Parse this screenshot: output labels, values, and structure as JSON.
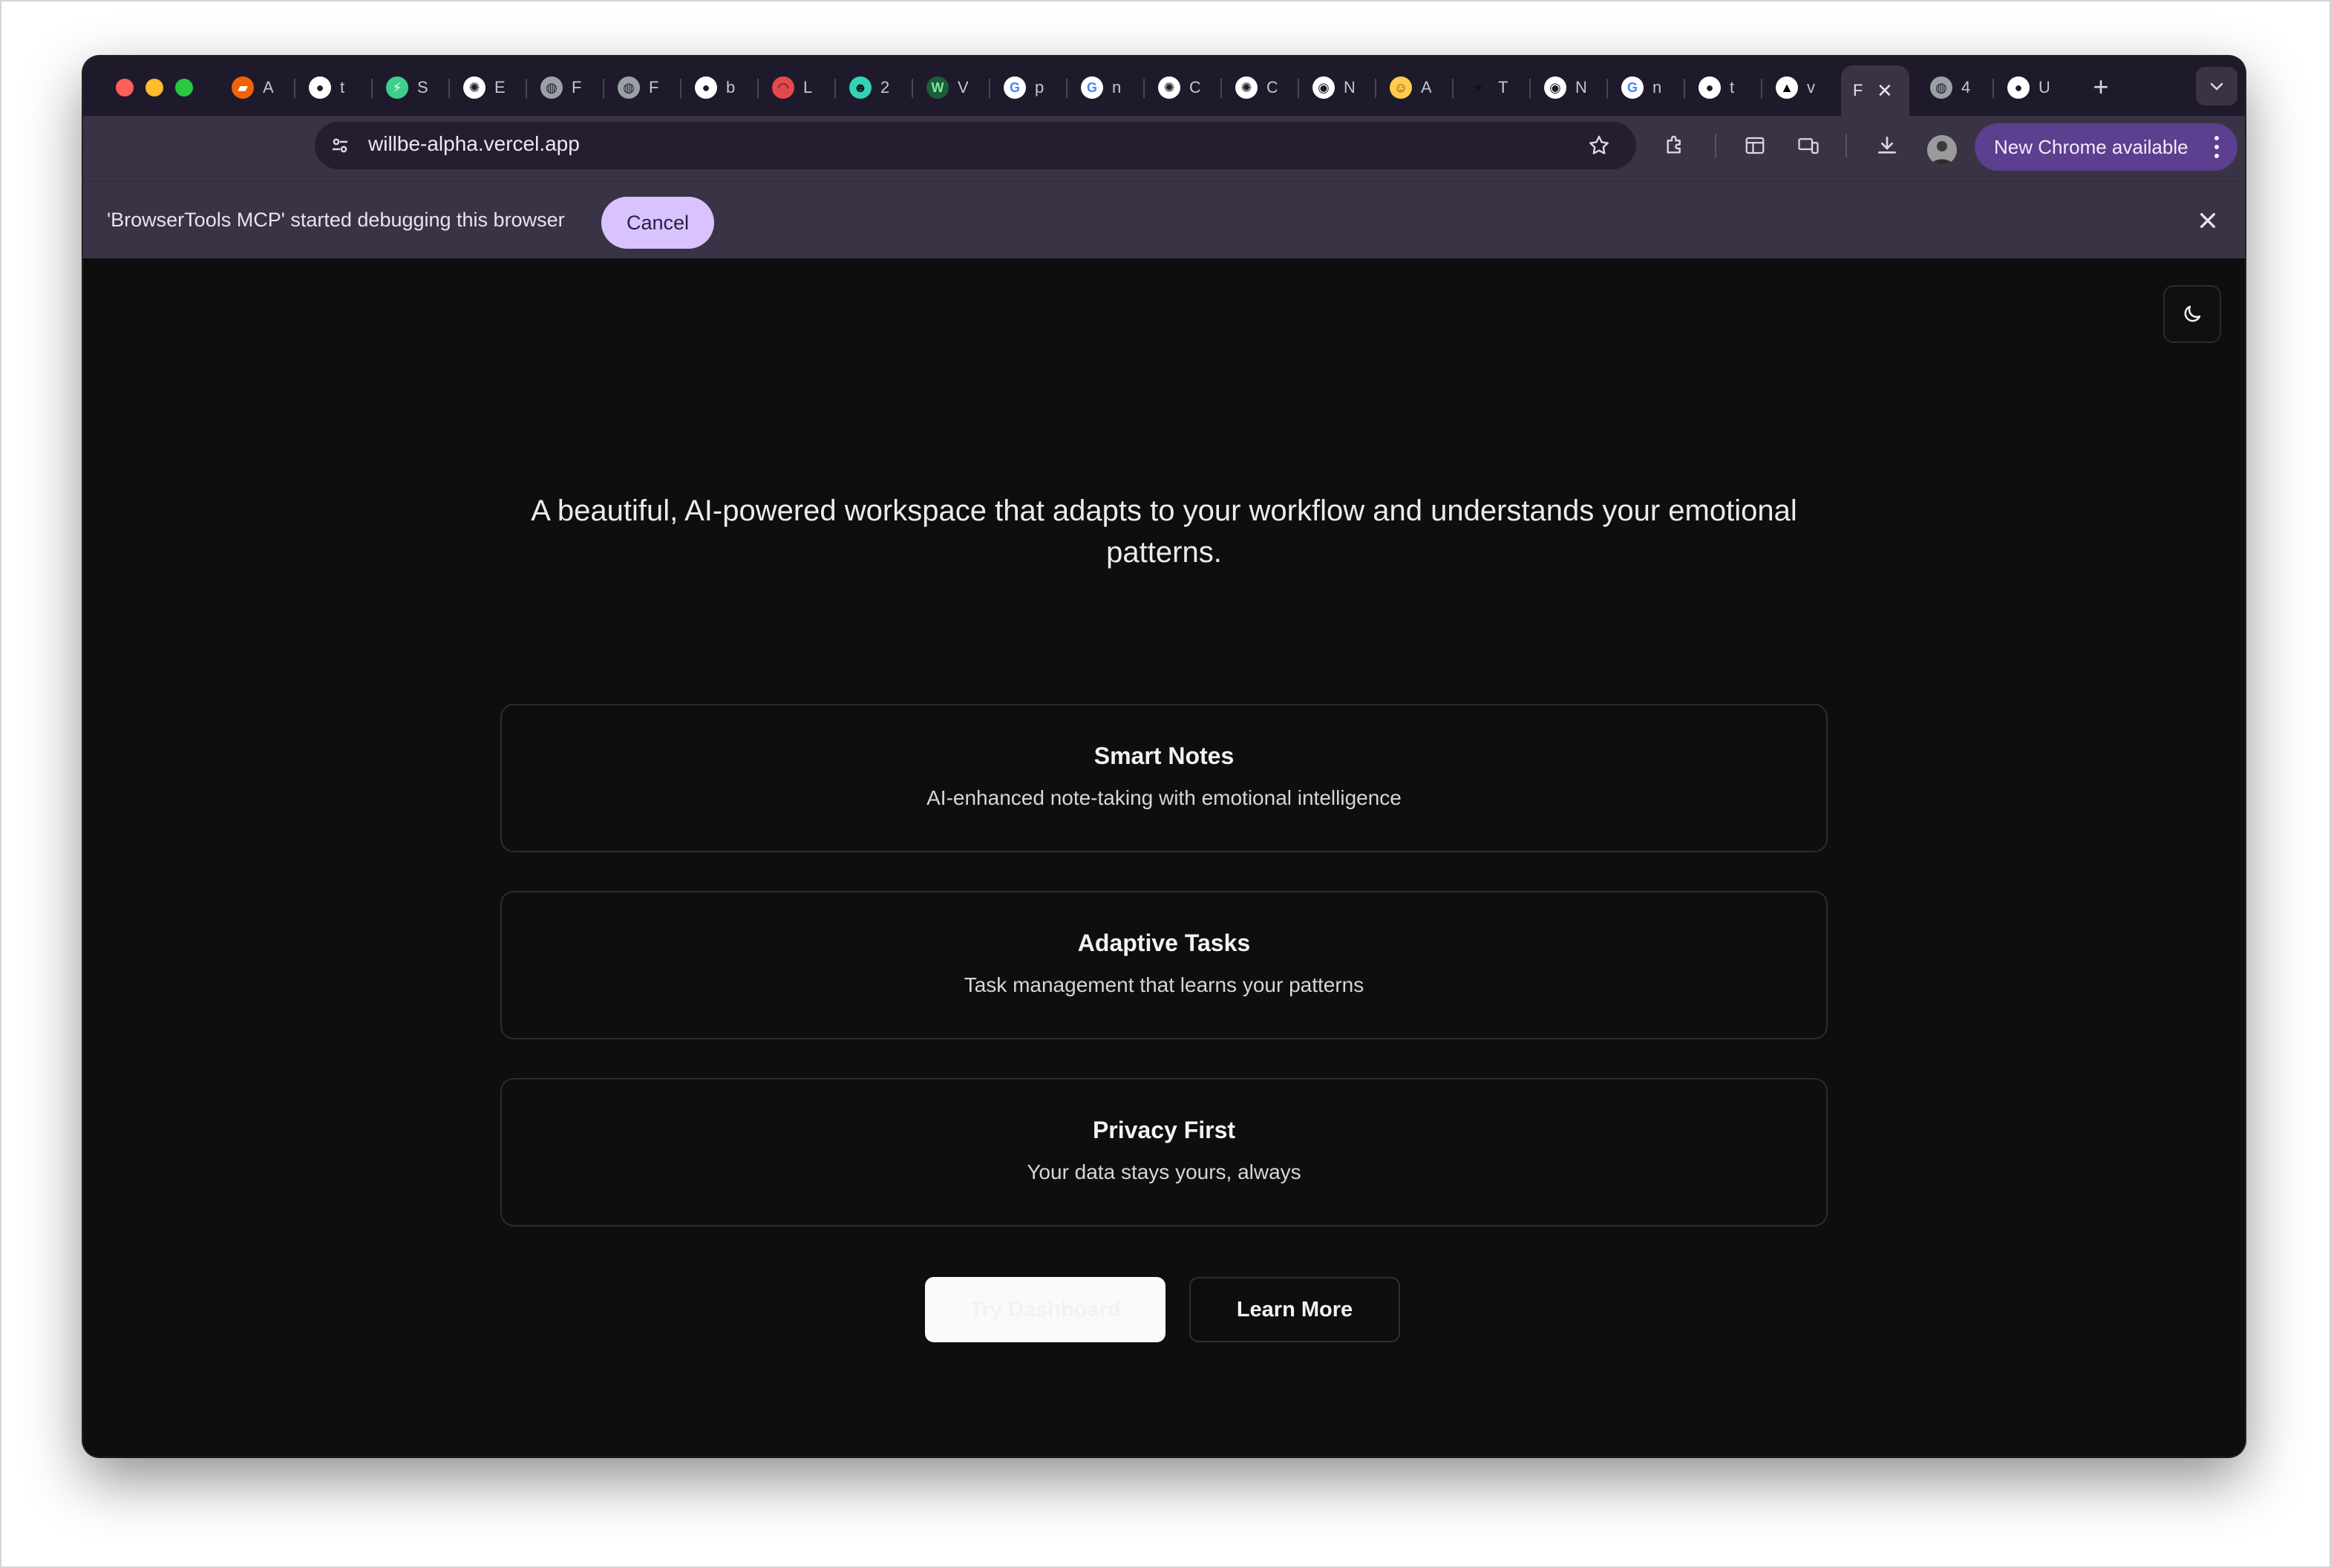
{
  "browser": {
    "tabs": [
      {
        "label": "A",
        "icon": "replit-icon"
      },
      {
        "label": "t",
        "icon": "github-icon"
      },
      {
        "label": "S",
        "icon": "supabase-icon"
      },
      {
        "label": "E",
        "icon": "openai-icon"
      },
      {
        "label": "F",
        "icon": "globe-icon"
      },
      {
        "label": "F",
        "icon": "globe-icon"
      },
      {
        "label": "b",
        "icon": "github-icon"
      },
      {
        "label": "L",
        "icon": "spiral-icon"
      },
      {
        "label": "2",
        "icon": "bot-icon"
      },
      {
        "label": "V",
        "icon": "wix-icon"
      },
      {
        "label": "p",
        "icon": "google-icon"
      },
      {
        "label": "n",
        "icon": "google-icon"
      },
      {
        "label": "C",
        "icon": "openai-icon"
      },
      {
        "label": "C",
        "icon": "openai-icon"
      },
      {
        "label": "N",
        "icon": "chrome-icon"
      },
      {
        "label": "A",
        "icon": "huggingface-icon"
      },
      {
        "label": "T",
        "icon": "star-icon"
      },
      {
        "label": "N",
        "icon": "chrome-icon"
      },
      {
        "label": "n",
        "icon": "google-icon"
      },
      {
        "label": "t",
        "icon": "github-icon"
      },
      {
        "label": "v",
        "icon": "vercel-icon"
      },
      {
        "label": "F",
        "icon": "active-tab",
        "active": true
      },
      {
        "label": "4",
        "icon": "globe-icon"
      },
      {
        "label": "U",
        "icon": "github-icon"
      }
    ],
    "url": "willbe-alpha.vercel.app",
    "update_label": "New Chrome available",
    "infobar": {
      "message": "'BrowserTools MCP' started debugging this browser",
      "cancel_label": "Cancel"
    }
  },
  "page": {
    "tagline": "A beautiful, AI-powered workspace that adapts to your workflow and understands your emotional patterns.",
    "features": [
      {
        "title": "Smart Notes",
        "description": "AI-enhanced note-taking with emotional intelligence"
      },
      {
        "title": "Adaptive Tasks",
        "description": "Task management that learns your patterns"
      },
      {
        "title": "Privacy First",
        "description": "Your data stays yours, always"
      }
    ],
    "primary_button": "Try Dashboard",
    "secondary_button": "Learn More"
  },
  "colors": {
    "page_bg": "#0e0e0e",
    "chrome_bg": "#1f1a2b",
    "toolbar_bg": "#3a3346",
    "accent": "#d8c3ff",
    "update_pill": "#5c3f8e"
  }
}
